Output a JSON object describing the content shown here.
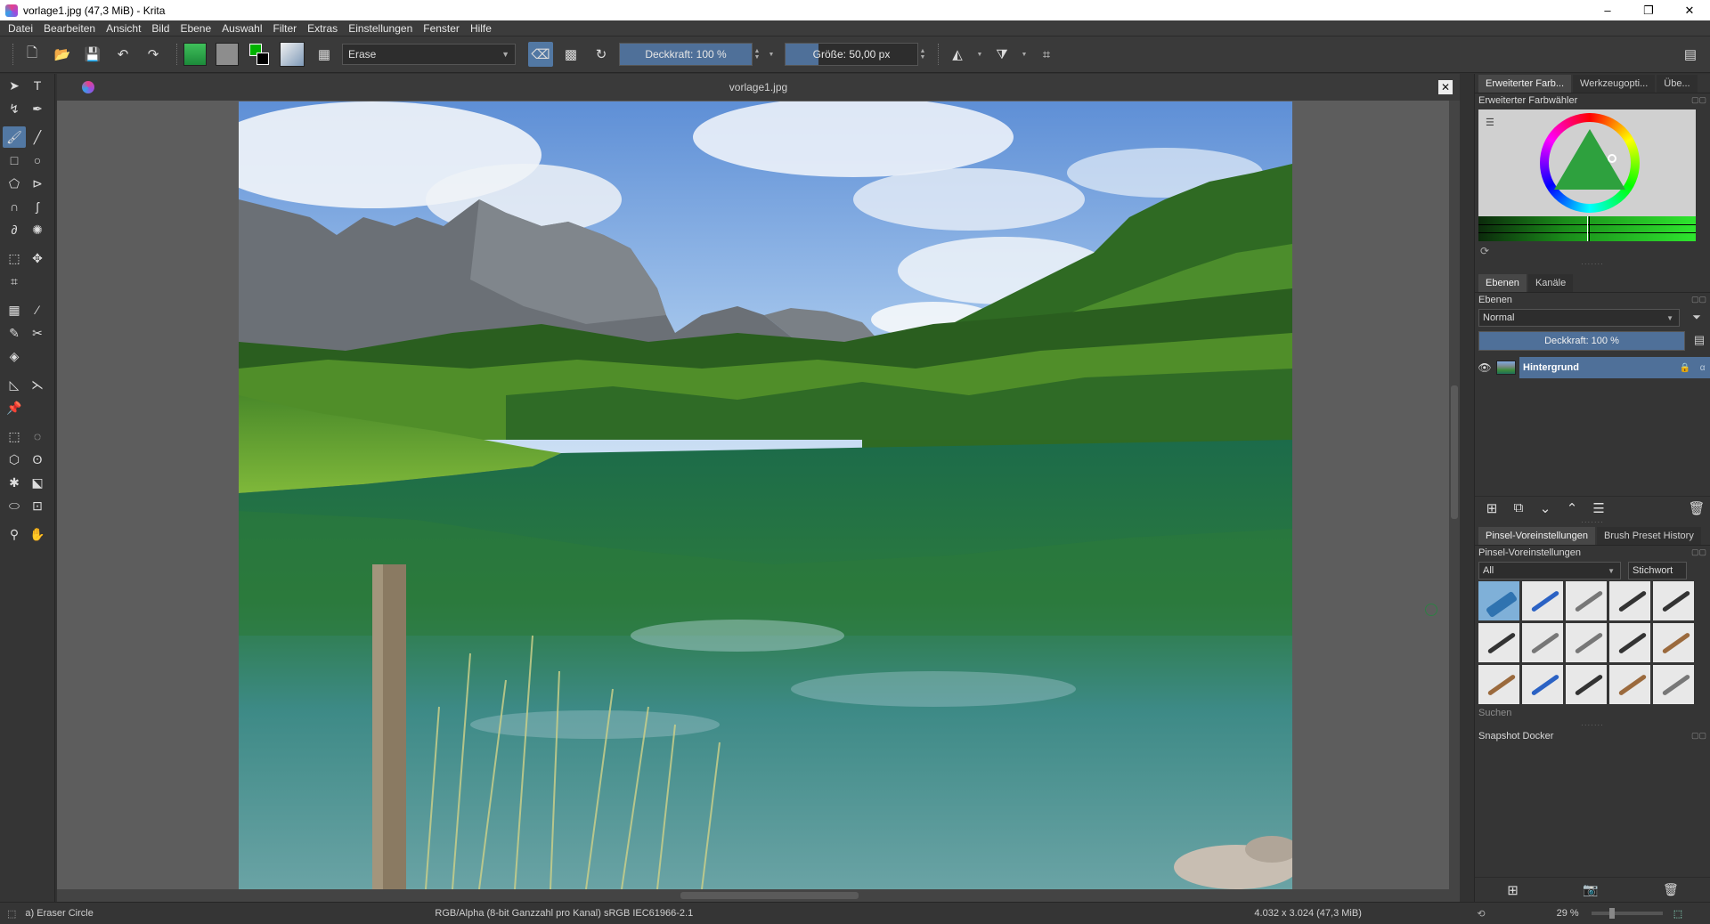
{
  "window": {
    "title": "vorlage1.jpg (47,3 MiB)  - Krita",
    "min": "–",
    "max": "❐",
    "close": "✕"
  },
  "menu": [
    "Datei",
    "Bearbeiten",
    "Ansicht",
    "Bild",
    "Ebene",
    "Auswahl",
    "Filter",
    "Extras",
    "Einstellungen",
    "Fenster",
    "Hilfe"
  ],
  "toolbar": {
    "blend_mode": "Erase",
    "opacity_label": "Deckkraft:  100 %",
    "opacity_value": 100,
    "size_label": "Größe:  50,00 px",
    "size_value": 50
  },
  "canvas": {
    "tab_title": "vorlage1.jpg",
    "close": "✕"
  },
  "dockers": {
    "top_tabs": [
      "Erweiterter Farb...",
      "Werkzeugopti...",
      "Übe..."
    ],
    "color_selector_title": "Erweiterter Farbwähler",
    "layer_tabs": [
      "Ebenen",
      "Kanäle"
    ],
    "layers_title": "Ebenen",
    "layer_blend": "Normal",
    "layer_opacity": "Deckkraft:  100 %",
    "layer_name": "Hintergrund",
    "brush_tabs": [
      "Pinsel-Voreinstellungen",
      "Brush Preset History"
    ],
    "brush_title": "Pinsel-Voreinstellungen",
    "brush_filter": "All",
    "brush_tag": "Stichwort",
    "search_label": "Suchen",
    "snapshot_title": "Snapshot Docker"
  },
  "status": {
    "tool": "a) Eraser Circle",
    "color_space": "RGB/Alpha (8-bit Ganzzahl pro Kanal)  sRGB IEC61966-2.1",
    "dimensions": "4.032 x 3.024 (47,3 MiB)",
    "zoom": "29 %"
  },
  "colors": {
    "accent": "#5278a3",
    "foreground": "#00b200",
    "background": "#000000"
  }
}
